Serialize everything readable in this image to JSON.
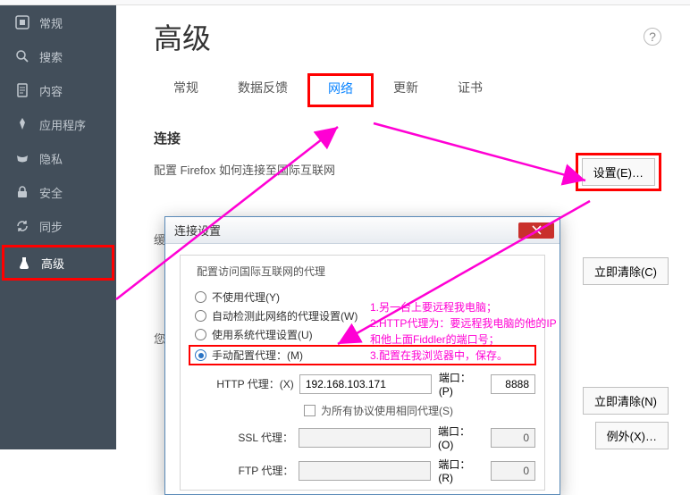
{
  "sidebar": {
    "items": [
      {
        "label": "常规",
        "icon": "general"
      },
      {
        "label": "搜索",
        "icon": "search"
      },
      {
        "label": "内容",
        "icon": "content"
      },
      {
        "label": "应用程序",
        "icon": "apps"
      },
      {
        "label": "隐私",
        "icon": "privacy"
      },
      {
        "label": "安全",
        "icon": "security"
      },
      {
        "label": "同步",
        "icon": "sync"
      },
      {
        "label": "高级",
        "icon": "advanced"
      }
    ]
  },
  "page": {
    "title": "高级",
    "help_tooltip": "?"
  },
  "tabs": [
    {
      "label": "常规"
    },
    {
      "label": "数据反馈"
    },
    {
      "label": "网络"
    },
    {
      "label": "更新"
    },
    {
      "label": "证书"
    }
  ],
  "connection": {
    "heading": "连接",
    "desc": "配置 Firefox 如何连接至国际互联网",
    "settings_btn": "设置(E)…"
  },
  "cache_hidden": {
    "label1": "缓",
    "label2": "您",
    "btn1": "立即清除(C)",
    "btn2": "立即清除(N)",
    "btn3": "例外(X)…"
  },
  "dialog": {
    "title": "连接设置",
    "group_title": "配置访问国际互联网的代理",
    "radios": {
      "none": "不使用代理(Y)",
      "auto": "自动检测此网络的代理设置(W)",
      "system": "使用系统代理设置(U)",
      "manual": "手动配置代理：(M)"
    },
    "http": {
      "label": "HTTP 代理：(X)",
      "value": "192.168.103.171",
      "port_label": "端口：(P)",
      "port_value": "8888"
    },
    "same_all": "为所有协议使用相同代理(S)",
    "ssl": {
      "label": "SSL 代理：",
      "value": "",
      "port_label": "端口：(O)",
      "port_value": "0"
    },
    "ftp": {
      "label": "FTP 代理：",
      "value": "",
      "port_label": "端口：(R)",
      "port_value": "0"
    }
  },
  "annotation": {
    "line1": "1.另一台上要远程我电脑；",
    "line2": "2.HTTP代理为：要远程我电脑的他的IP和他上面Fiddler的端口号；",
    "line3": "3.配置在我浏览器中，保存。"
  }
}
